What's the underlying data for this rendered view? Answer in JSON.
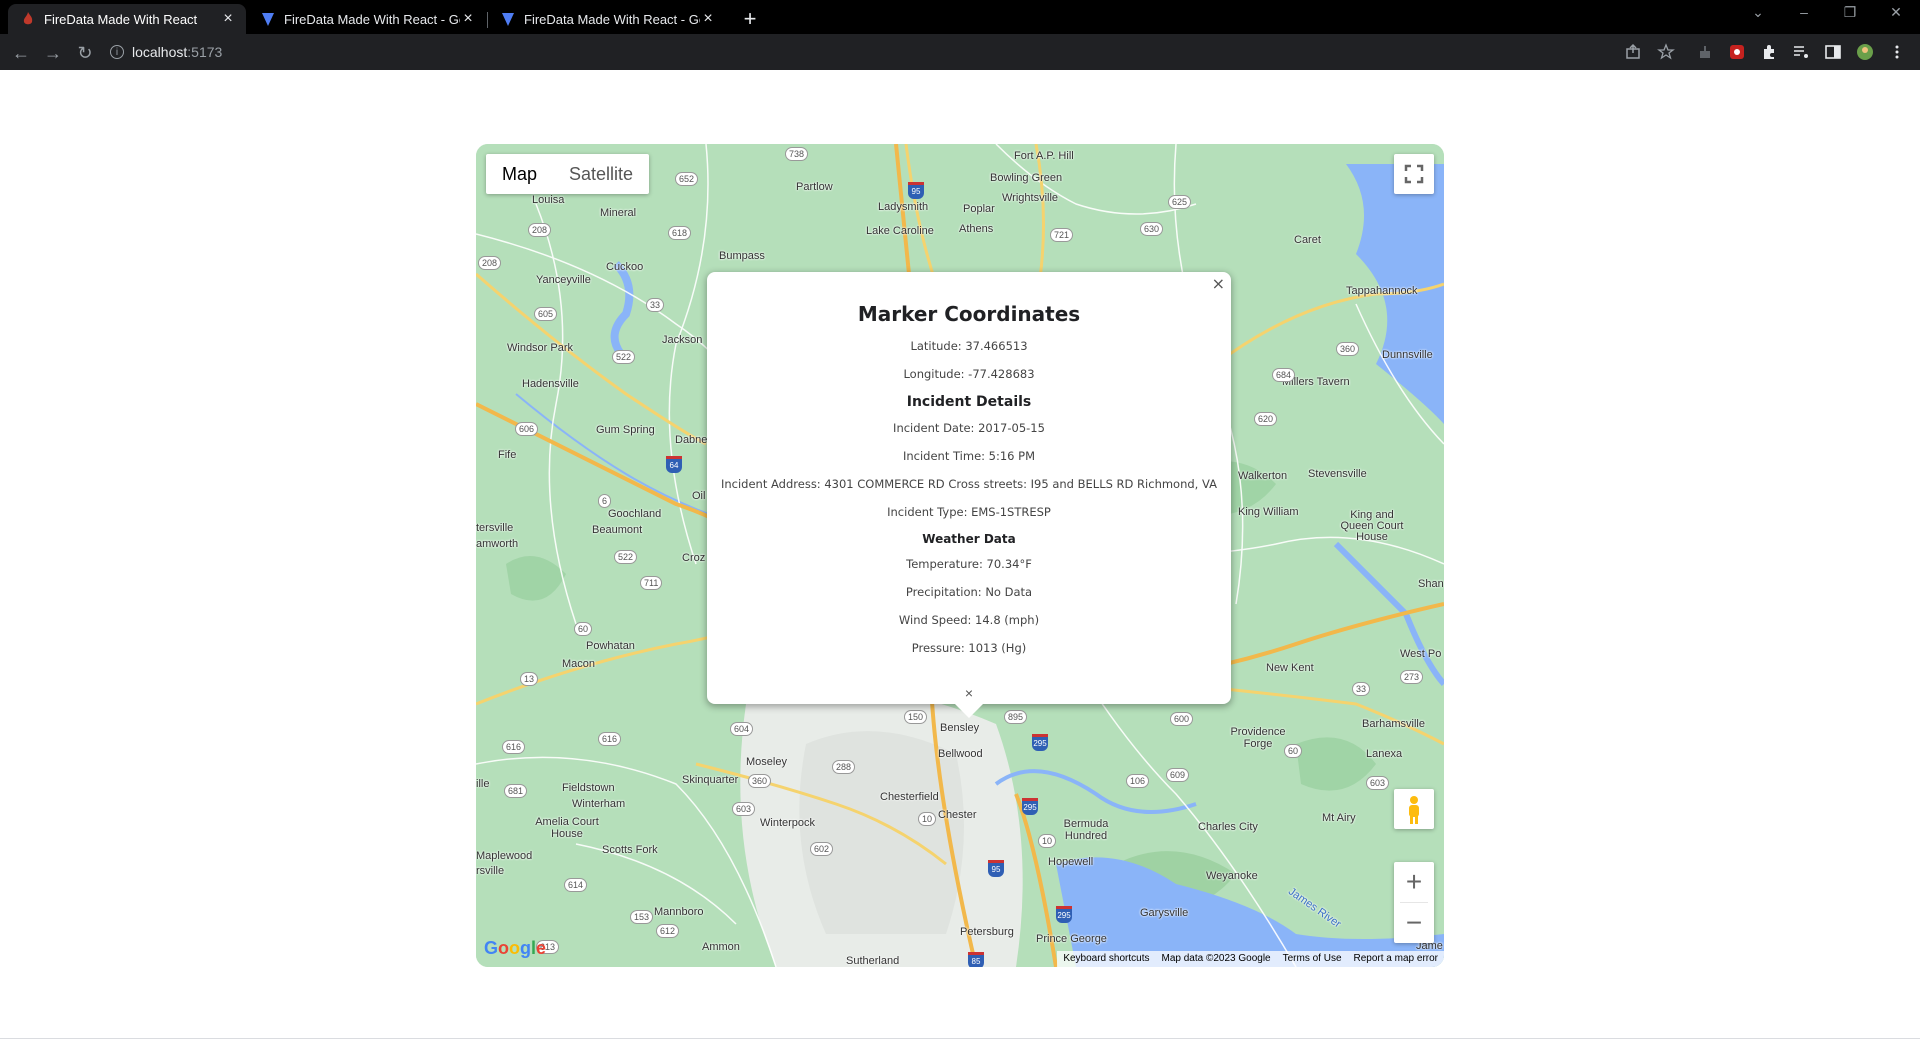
{
  "browser": {
    "tabs": [
      {
        "title": "FireData Made With React",
        "active": true
      },
      {
        "title": "FireData Made With React - Goo",
        "active": false
      },
      {
        "title": "FireData Made With React - Goo",
        "active": false
      }
    ],
    "url_host": "localhost",
    "url_port": ":5173"
  },
  "map": {
    "type_buttons": {
      "map": "Map",
      "satellite": "Satellite",
      "selected": "Map"
    },
    "labels": {
      "fort_ap_hill": "Fort A.P. Hill",
      "bowling_green": "Bowling Green",
      "wrightsville": "Wrightsville",
      "partlow": "Partlow",
      "ladysmith": "Ladysmith",
      "poplar": "Poplar",
      "lake_caroline": "Lake Caroline",
      "athens": "Athens",
      "louisa": "Louisa",
      "mineral": "Mineral",
      "bumpass": "Bumpass",
      "cuckoo": "Cuckoo",
      "yanceyville": "Yanceyville",
      "caret": "Caret",
      "tappahannock": "Tappahannock",
      "dunnsville": "Dunnsville",
      "millers_tavern": "Millers Tavern",
      "windsor_park": "Windsor Park",
      "jackson": "Jackson",
      "hadensville": "Hadensville",
      "gum_spring": "Gum Spring",
      "dabne": "Dabne",
      "fife": "Fife",
      "goochland": "Goochland",
      "oil": "Oil",
      "beaumont": "Beaumont",
      "tersville": "tersville",
      "amworth": "amworth",
      "croz": "Croz",
      "walkerton": "Walkerton",
      "stevensville": "Stevensville",
      "king_william": "King William",
      "king_queen": "King and Queen Court House",
      "shan": "Shan",
      "powhatan": "Powhatan",
      "macon": "Macon",
      "new_kent": "New Kent",
      "west_po": "West Po",
      "providence_forge": "Providence Forge",
      "barhamsville": "Barhamsville",
      "lanexa": "Lanexa",
      "bensley": "Bensley",
      "bellwood": "Bellwood",
      "moseley": "Moseley",
      "skinquarter": "Skinquarter",
      "fieldstown": "Fieldstown",
      "winterham": "Winterham",
      "chesterfield": "Chesterfield",
      "chester": "Chester",
      "winterpock": "Winterpock",
      "amelia": "Amelia Court House",
      "scotts_fork": "Scotts Fork",
      "bermuda_hundred": "Bermuda Hundred",
      "charles_city": "Charles City",
      "mt_airy": "Mt Airy",
      "maplewood": "Maplewood",
      "rsville": "rsville",
      "hopewell": "Hopewell",
      "weyanoke": "Weyanoke",
      "garysville": "Garysville",
      "mannboro": "Mannboro",
      "ammon": "Ammon",
      "petersburg": "Petersburg",
      "prince_george": "Prince George",
      "sutherland": "Sutherland",
      "james_river": "James River",
      "jame": "Jame",
      "ille": "ille"
    },
    "attribution": {
      "shortcuts": "Keyboard shortcuts",
      "data": "Map data ©2023 Google",
      "terms": "Terms of Use",
      "report": "Report a map error"
    },
    "google_logo": "Google"
  },
  "info_window": {
    "title": "Marker Coordinates",
    "latitude": "Latitude: 37.466513",
    "longitude": "Longitude: -77.428683",
    "incident_heading": "Incident Details",
    "incident_date": "Incident Date: 2017-05-15",
    "incident_time": "Incident Time: 5:16 PM",
    "incident_address": "Incident Address: 4301 COMMERCE RD Cross streets: I95 and BELLS RD Richmond, VA",
    "incident_type": "Incident Type: EMS-1STRESP",
    "weather_heading": "Weather Data",
    "temperature": "Temperature: 70.34°F",
    "precipitation": "Precipitation: No Data",
    "wind_speed": "Wind Speed: 14.8 (mph)",
    "pressure": "Pressure: 1013 (Hg)"
  }
}
